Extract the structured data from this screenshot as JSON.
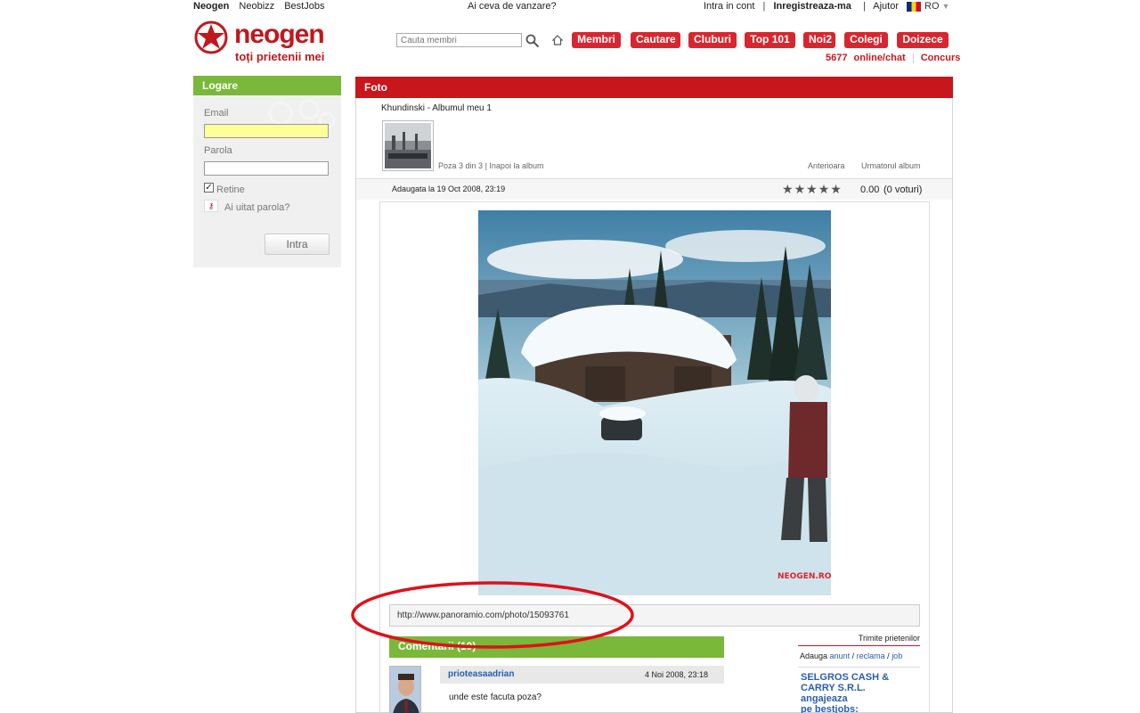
{
  "topbar": {
    "links": [
      "Neogen",
      "Neobizz",
      "BestJobs"
    ],
    "center": "Ai ceva de vanzare?",
    "intra": "Intra in cont",
    "register": "Inregistreaza-ma",
    "help": "Ajutor",
    "lang": "RO",
    "sep": "|"
  },
  "logo": {
    "word": "neogen",
    "tagline": "toți prietenii mei"
  },
  "search": {
    "placeholder": "Cauta membri"
  },
  "nav": [
    "Membri",
    "Cautare",
    "Cluburi",
    "Top 101",
    "Noi2",
    "Colegi",
    "Doizece"
  ],
  "online": {
    "count": "5677",
    "label": "online/chat",
    "contest": "Concurs"
  },
  "login": {
    "title": "Logare",
    "email_label": "Email",
    "password_label": "Parola",
    "remember_label": "Retine",
    "forgot_label": "Ai uitat parola?",
    "submit": "Intra"
  },
  "foto": {
    "title": "Foto",
    "album": "Khundinski - Albumul meu 1",
    "position": "Poza 3 din 3",
    "back_link": "Inapoi la album",
    "divider": "|",
    "prev": "Anterioara",
    "next_album": "Urmatorul album",
    "added": "Adaugata la 19 Oct 2008, 23:19",
    "rating_value": "0.00",
    "votes": "(0 voturi)",
    "url": "http://www.panoramio.com/photo/15093761",
    "watermark": "NEOGEN.RO"
  },
  "comments": {
    "title": "Comentarii (10)",
    "items": [
      {
        "user": "prioteasaadrian",
        "date": "4 Noi 2008, 23:18",
        "text": "unde este facuta poza?"
      }
    ]
  },
  "side": {
    "send": "Trimite prietenilor",
    "add_prefix": "Adauga",
    "add_links": [
      "anunt",
      "reclama",
      "job"
    ],
    "slash": "/",
    "ad_line1": "SELGROS CASH &",
    "ad_line2": "CARRY S.R.L.",
    "ad_line3": "angajeaza",
    "ad_line4": "pe bestjobs:"
  },
  "colors": {
    "brand_red": "#c8161d",
    "green": "#7ab83a",
    "link_blue": "#2a5db0"
  }
}
